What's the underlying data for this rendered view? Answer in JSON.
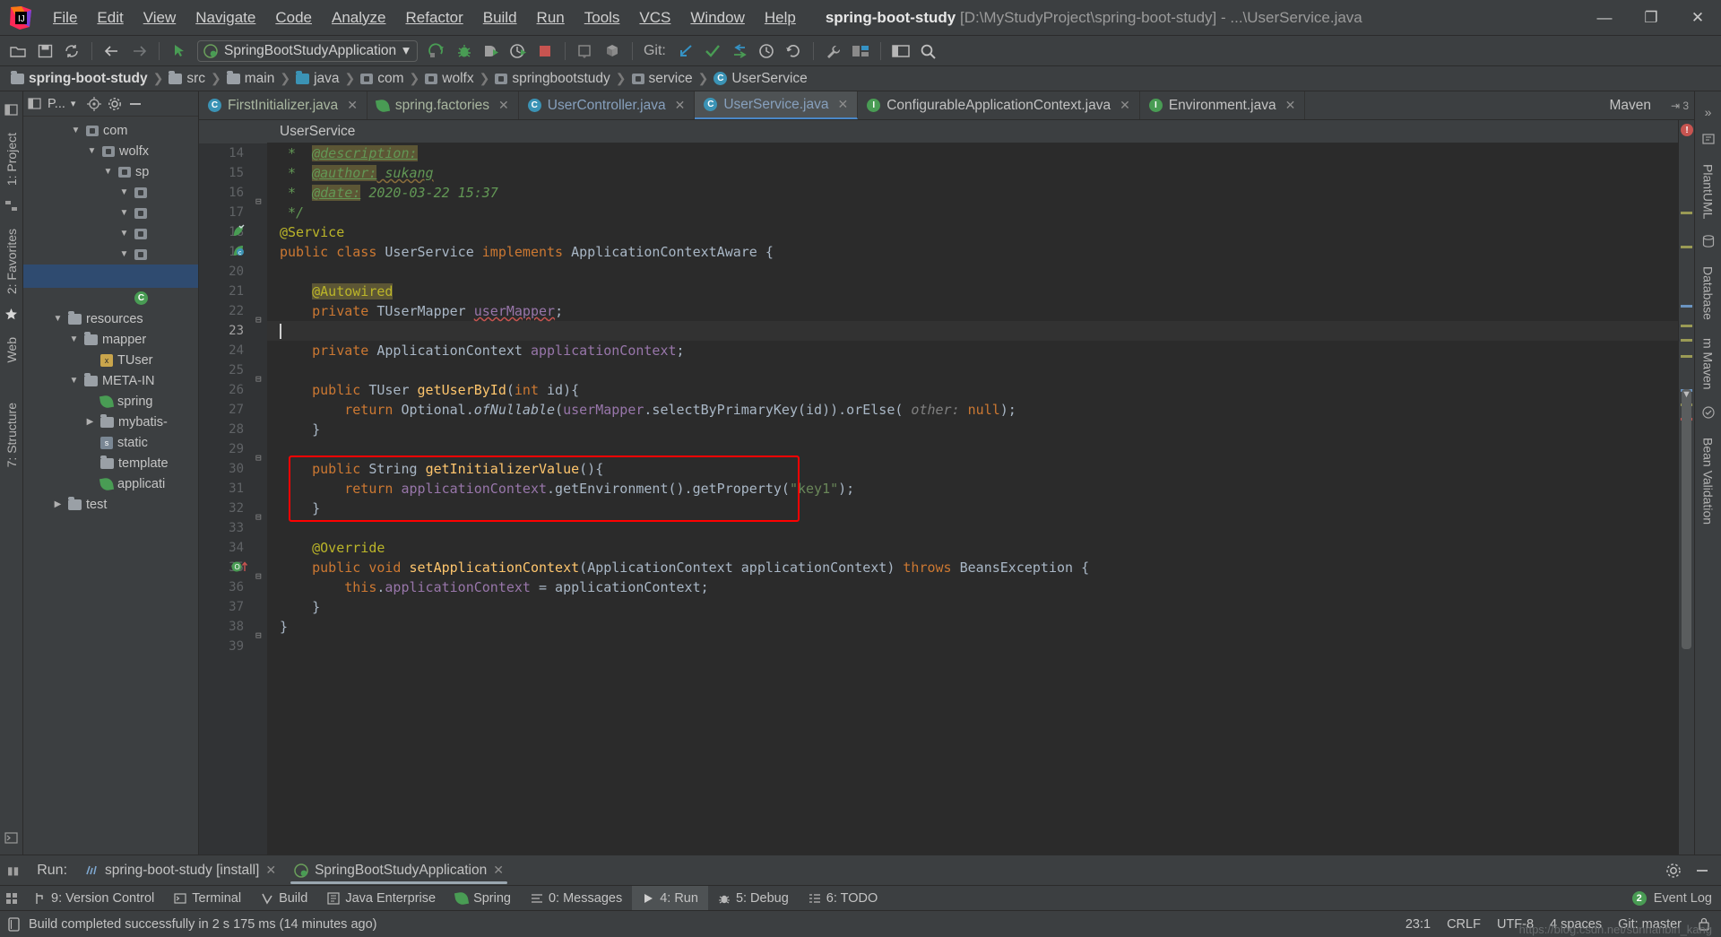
{
  "window": {
    "app_icon": "intellij-logo",
    "title_project": "spring-boot-study",
    "title_path": "[D:\\MyStudyProject\\spring-boot-study] - ...\\UserService.java",
    "minimize": "—",
    "maximize": "❐",
    "close": "✕"
  },
  "menu": [
    {
      "label": "File"
    },
    {
      "label": "Edit"
    },
    {
      "label": "View"
    },
    {
      "label": "Navigate"
    },
    {
      "label": "Code"
    },
    {
      "label": "Analyze"
    },
    {
      "label": "Refactor"
    },
    {
      "label": "Build"
    },
    {
      "label": "Run"
    },
    {
      "label": "Tools"
    },
    {
      "label": "VCS"
    },
    {
      "label": "Window"
    },
    {
      "label": "Help"
    }
  ],
  "toolbar": {
    "open_icon": "open-folder-icon",
    "save_icon": "save-icon",
    "sync_icon": "sync-icon",
    "back_icon": "back-arrow-icon",
    "forward_icon": "forward-arrow-icon",
    "pointer_icon": "cursor-icon",
    "run_config": "SpringBootStudyApplication",
    "run_config_caret": "▾",
    "run_icon": "run-icon",
    "debug_icon": "debug-icon",
    "coverage_icon": "run-with-coverage-icon",
    "profile_icon": "profiler-icon",
    "stop_icon": "stop-icon",
    "build_icon": "build-project-icon",
    "package_icon": "package-icon",
    "git_label": "Git:",
    "git_update_icon": "update-project-icon",
    "git_commit_icon": "commit-icon",
    "git_push_icon": "push-icon",
    "git_history_icon": "history-icon",
    "undo_icon": "undo-icon",
    "settings_icon": "wrench-icon",
    "project_structure_icon": "project-structure-icon",
    "layout_icon": "layout-icon",
    "search_icon": "search-everywhere-icon"
  },
  "breadcrumb": [
    {
      "label": "spring-boot-study",
      "icon": "folder-icon"
    },
    {
      "label": "src",
      "icon": "folder-icon"
    },
    {
      "label": "main",
      "icon": "folder-icon"
    },
    {
      "label": "java",
      "icon": "folder-blue-icon"
    },
    {
      "label": "com",
      "icon": "package-icon"
    },
    {
      "label": "wolfx",
      "icon": "package-icon"
    },
    {
      "label": "springbootstudy",
      "icon": "package-icon"
    },
    {
      "label": "service",
      "icon": "package-icon"
    },
    {
      "label": "UserService",
      "icon": "class-icon"
    }
  ],
  "left_rail": {
    "project_label": "1: Project",
    "favorites_label": "2: Favorites",
    "web_label": "Web",
    "structure_label": "7: Structure",
    "bottom_icon": "terminal-icon"
  },
  "project_panel": {
    "header_title": "P...",
    "header_caret": "▾",
    "icons": [
      "project-view-icon",
      "locate-icon",
      "gear-icon",
      "collapse-icon"
    ],
    "tree": [
      {
        "indent": 2,
        "twisty": "▼",
        "icon": "package-icon",
        "label": "com"
      },
      {
        "indent": 3,
        "twisty": "▼",
        "icon": "package-icon",
        "label": "wolfx"
      },
      {
        "indent": 4,
        "twisty": "▼",
        "icon": "package-icon",
        "label": "sp"
      },
      {
        "indent": 5,
        "twisty": "▼",
        "icon": "package-icon",
        "label": ""
      },
      {
        "indent": 5,
        "twisty": "▼",
        "icon": "package-icon",
        "label": ""
      },
      {
        "indent": 5,
        "twisty": "▼",
        "icon": "package-icon",
        "label": ""
      },
      {
        "indent": 5,
        "twisty": "▼",
        "icon": "package-icon",
        "label": ""
      },
      {
        "indent": 5,
        "twisty": "",
        "icon": "",
        "label": "",
        "selected": true
      },
      {
        "indent": 5,
        "twisty": "",
        "icon": "class-icon",
        "label": ""
      },
      {
        "indent": 1,
        "twisty": "▼",
        "icon": "folder-icon",
        "label": "resources"
      },
      {
        "indent": 2,
        "twisty": "▼",
        "icon": "folder-icon",
        "label": "mapper"
      },
      {
        "indent": 3,
        "twisty": "",
        "icon": "xml-icon",
        "label": "TUser"
      },
      {
        "indent": 2,
        "twisty": "▼",
        "icon": "folder-icon",
        "label": "META-IN"
      },
      {
        "indent": 3,
        "twisty": "",
        "icon": "spring-icon",
        "label": "spring"
      },
      {
        "indent": 2,
        "twisty": "▶",
        "icon": "folder-icon",
        "label": "mybatis-"
      },
      {
        "indent": 2,
        "twisty": "",
        "icon": "static-icon",
        "label": "static"
      },
      {
        "indent": 2,
        "twisty": "",
        "icon": "folder-icon",
        "label": "template"
      },
      {
        "indent": 2,
        "twisty": "",
        "icon": "spring-icon",
        "label": "applicati"
      },
      {
        "indent": 1,
        "twisty": "▶",
        "icon": "folder-icon",
        "label": "test"
      }
    ]
  },
  "editor_tabs": [
    {
      "label": "FirstInitializer.java",
      "icon": "java-class-icon",
      "active": false,
      "color": "green"
    },
    {
      "label": "spring.factories",
      "icon": "spring-icon",
      "active": false,
      "color": "green"
    },
    {
      "label": "UserController.java",
      "icon": "java-class-icon",
      "active": false,
      "color": "blue"
    },
    {
      "label": "UserService.java",
      "icon": "java-class-icon",
      "active": true,
      "color": "blue"
    },
    {
      "label": "ConfigurableApplicationContext.java",
      "icon": "java-interface-icon",
      "active": false,
      "color": "grey"
    },
    {
      "label": "Environment.java",
      "icon": "java-interface-icon",
      "active": false,
      "color": "grey"
    }
  ],
  "tabs_overflow": "⇥ 3",
  "maven_panel_label": "Maven",
  "right_rail": [
    {
      "label": "PlantUML"
    },
    {
      "label": "Database"
    },
    {
      "label": "m  Maven"
    },
    {
      "label": "Bean Validation"
    }
  ],
  "editor": {
    "sticky_header": "UserService",
    "first_line": 14,
    "lines": [
      {
        "n": 14,
        "text": " *  @description:"
      },
      {
        "n": 15,
        "text": " *  @author: sukang"
      },
      {
        "n": 16,
        "text": " *  @date: 2020-03-22 15:37"
      },
      {
        "n": 17,
        "text": " */"
      },
      {
        "n": 18,
        "text": "@Service"
      },
      {
        "n": 19,
        "text": "public class UserService implements ApplicationContextAware {"
      },
      {
        "n": 20,
        "text": ""
      },
      {
        "n": 21,
        "text": "    @Autowired"
      },
      {
        "n": 22,
        "text": "    private TUserMapper userMapper;"
      },
      {
        "n": 23,
        "text": "",
        "current": true
      },
      {
        "n": 24,
        "text": "    private ApplicationContext applicationContext;"
      },
      {
        "n": 25,
        "text": ""
      },
      {
        "n": 26,
        "text": "    public TUser getUserById(int id){"
      },
      {
        "n": 27,
        "text": "        return Optional.ofNullable(userMapper.selectByPrimaryKey(id)).orElse( other: null);"
      },
      {
        "n": 28,
        "text": "    }"
      },
      {
        "n": 29,
        "text": ""
      },
      {
        "n": 30,
        "text": "    public String getInitializerValue(){"
      },
      {
        "n": 31,
        "text": "        return applicationContext.getEnvironment().getProperty(\"key1\");"
      },
      {
        "n": 32,
        "text": "    }"
      },
      {
        "n": 33,
        "text": ""
      },
      {
        "n": 34,
        "text": "    @Override"
      },
      {
        "n": 35,
        "text": "    public void setApplicationContext(ApplicationContext applicationContext) throws BeansException {"
      },
      {
        "n": 36,
        "text": "        this.applicationContext = applicationContext;"
      },
      {
        "n": 37,
        "text": "    }"
      },
      {
        "n": 38,
        "text": "}"
      },
      {
        "n": 39,
        "text": ""
      }
    ],
    "highlight_box": {
      "color": "#ff0000",
      "from_line": 30,
      "to_line": 32
    }
  },
  "run_window": {
    "label": "Run:",
    "tabs": [
      {
        "label": "spring-boot-study [install]",
        "icon": "maven-icon",
        "active": false
      },
      {
        "label": "SpringBootStudyApplication",
        "icon": "spring-icon",
        "active": true
      }
    ],
    "settings_icon": "gear-icon",
    "hide_icon": "hide-icon"
  },
  "bottom_bar": {
    "items": [
      {
        "label": "9: Version Control",
        "icon": "branch-icon",
        "accel": "9",
        "active": false
      },
      {
        "label": "Terminal",
        "icon": "terminal-icon",
        "accel": "",
        "active": false
      },
      {
        "label": "Build",
        "icon": "build-icon",
        "accel": "",
        "active": false
      },
      {
        "label": "Java Enterprise",
        "icon": "java-enterprise-icon",
        "accel": "",
        "active": false
      },
      {
        "label": "Spring",
        "icon": "spring-leaf-icon",
        "accel": "",
        "active": false
      },
      {
        "label": "0: Messages",
        "icon": "messages-icon",
        "accel": "0",
        "active": false
      },
      {
        "label": "4: Run",
        "icon": "run-icon",
        "accel": "4",
        "active": true
      },
      {
        "label": "5: Debug",
        "icon": "debug-icon",
        "accel": "5",
        "active": false
      },
      {
        "label": "6: TODO",
        "icon": "todo-icon",
        "accel": "6",
        "active": false
      }
    ],
    "event_log": {
      "label": "Event Log",
      "badge": "2"
    }
  },
  "status_bar": {
    "icon": "build-status-icon",
    "message": "Build completed successfully in 2 s 175 ms (14 minutes ago)",
    "caret": "23:1",
    "line_sep": "CRLF",
    "encoding": "UTF-8",
    "indent": "4 spaces",
    "branch": "Git: master",
    "lock_icon": "lock-icon",
    "watermark": "https://blog.csdn.net/sunhanbin_kang"
  },
  "colors": {
    "bg_panel": "#3c3f41",
    "bg_editor": "#2b2b2b",
    "accent_blue": "#4a88c7",
    "error_red": "#c75450",
    "highlight_red": "#ff0000",
    "green": "#499c54",
    "keyword_orange": "#cc7832",
    "string_green": "#6a8759",
    "annotation_yellow": "#bbb529",
    "field_purple": "#9876aa",
    "method_gold": "#ffc66d"
  }
}
